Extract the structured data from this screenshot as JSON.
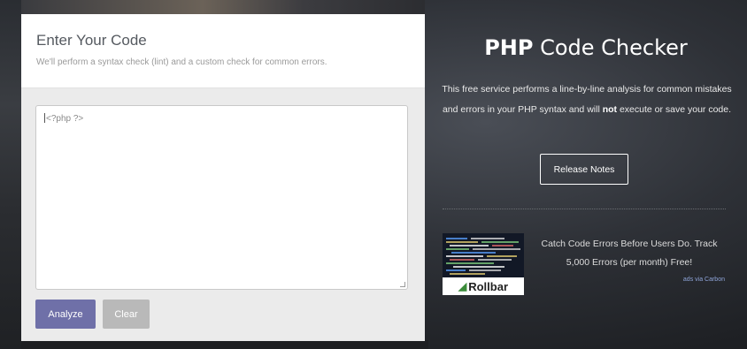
{
  "editor": {
    "title": "Enter Your Code",
    "subtitle": "We'll perform a syntax check (lint) and a custom check for common errors.",
    "code_value": "<?php ?>"
  },
  "actions": {
    "analyze_label": "Analyze",
    "clear_label": "Clear"
  },
  "hero": {
    "title_bold": "PHP",
    "title_rest": " Code Checker",
    "desc_part1": "This free service performs a line-by-line analysis for common mistakes and errors in your PHP syntax and will ",
    "desc_bold": "not",
    "desc_part2": " execute or save your code.",
    "release_notes_label": "Release Notes"
  },
  "ad": {
    "text": "Catch Code Errors Before Users Do. Track 5,000 Errors (per month) Free!",
    "via": "ads via Carbon",
    "brand": "Rollbar",
    "brand_mark_icon": "rollbar-logo-icon"
  },
  "colors": {
    "analyze_bg": "#6f70a8",
    "clear_bg": "#b9b9b9",
    "ad_via": "#8ea4d8"
  }
}
